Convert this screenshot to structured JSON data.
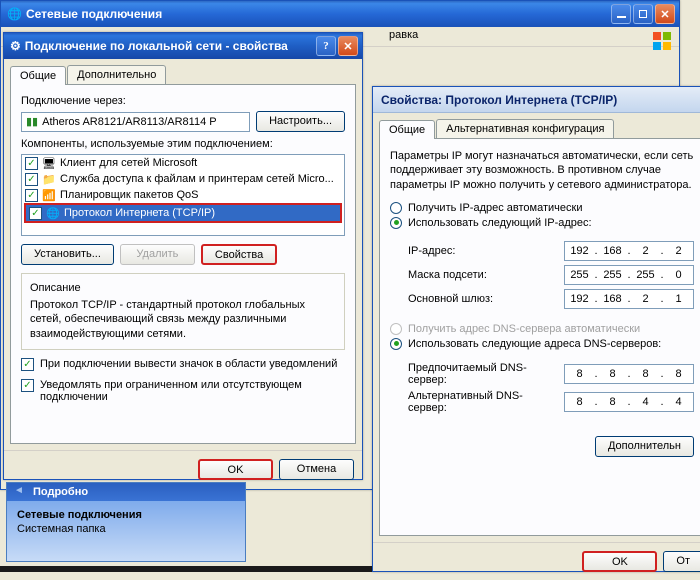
{
  "main_window": {
    "title": "Сетевые подключения",
    "menubar_visible_item": "равка"
  },
  "props_window": {
    "title": "Подключение по локальной сети - свойства",
    "tabs": [
      "Общие",
      "Дополнительно"
    ],
    "connect_using_label": "Подключение через:",
    "adapter": "Atheros AR8121/AR8113/AR8114 P",
    "configure_btn": "Настроить...",
    "components_label": "Компоненты, используемые этим подключением:",
    "components": [
      {
        "checked": true,
        "label": "Клиент для сетей Microsoft",
        "icon": "client"
      },
      {
        "checked": true,
        "label": "Служба доступа к файлам и принтерам сетей Micro...",
        "icon": "service"
      },
      {
        "checked": true,
        "label": "Планировщик пакетов QoS",
        "icon": "service"
      },
      {
        "checked": true,
        "label": "Протокол Интернета (TCP/IP)",
        "icon": "protocol",
        "selected": true
      }
    ],
    "install_btn": "Установить...",
    "remove_btn": "Удалить",
    "props_btn": "Свойства",
    "desc_title": "Описание",
    "desc_text": "Протокол TCP/IP - стандартный протокол глобальных сетей, обеспечивающий связь между различными взаимодействующими сетями.",
    "chk_tray": "При подключении вывести значок в области уведомлений",
    "chk_notify": "Уведомлять при ограниченном или отсутствующем подключении",
    "ok_btn": "OK",
    "cancel_btn": "Отмена"
  },
  "side_panel": {
    "header": "Подробно",
    "title": "Сетевые подключения",
    "subtitle": "Системная папка"
  },
  "tcp_window": {
    "title": "Свойства: Протокол Интернета (TCP/IP)",
    "tabs": [
      "Общие",
      "Альтернативная конфигурация"
    ],
    "help_text": "Параметры IP могут назначаться автоматически, если сеть поддерживает эту возможность. В противном случае параметры IP можно получить у сетевого администратора.",
    "ip_auto": "Получить IP-адрес автоматически",
    "ip_manual": "Использовать следующий IP-адрес:",
    "ip_label": "IP-адрес:",
    "ip_value": [
      "192",
      "168",
      "2",
      "2"
    ],
    "mask_label": "Маска подсети:",
    "mask_value": [
      "255",
      "255",
      "255",
      "0"
    ],
    "gw_label": "Основной шлюз:",
    "gw_value": [
      "192",
      "168",
      "2",
      "1"
    ],
    "dns_auto": "Получить адрес DNS-сервера автоматически",
    "dns_manual": "Использовать следующие адреса DNS-серверов:",
    "dns1_label": "Предпочитаемый DNS-сервер:",
    "dns1_value": [
      "8",
      "8",
      "8",
      "8"
    ],
    "dns2_label": "Альтернативный DNS-сервер:",
    "dns2_value": [
      "8",
      "8",
      "4",
      "4"
    ],
    "advanced_btn": "Дополнительн",
    "ok_btn": "OK",
    "cancel_btn": "От"
  }
}
